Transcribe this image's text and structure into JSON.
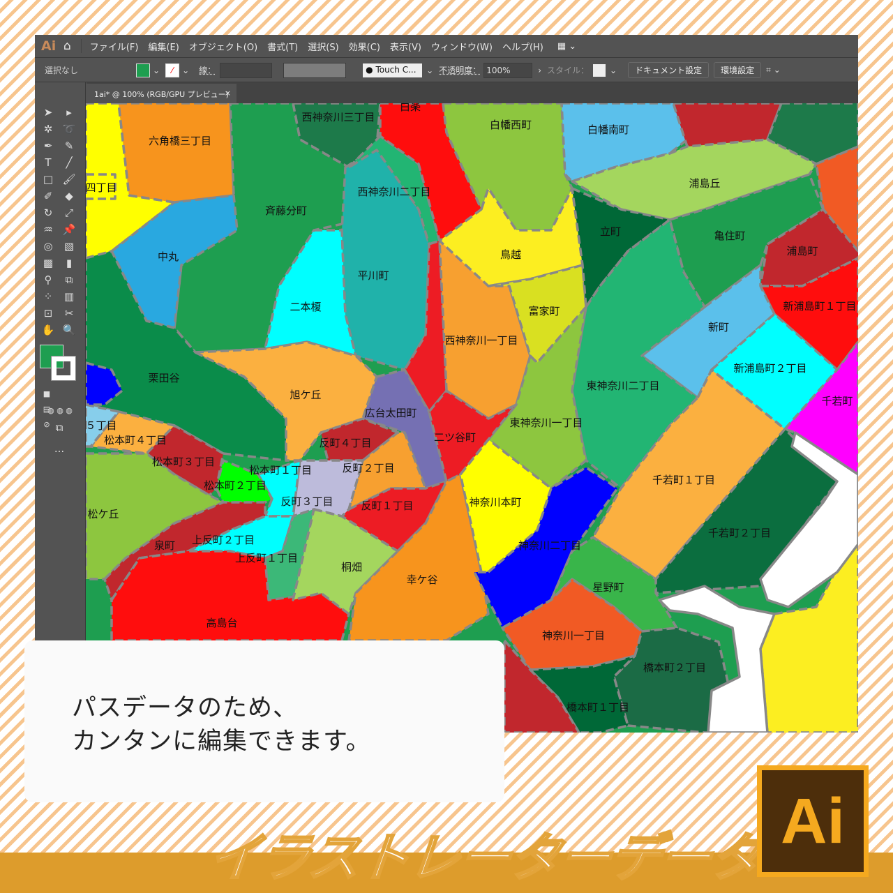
{
  "app": {
    "logo": "Ai",
    "home_icon": "home-icon",
    "menu": [
      "ファイル(F)",
      "編集(E)",
      "オブジェクト(O)",
      "書式(T)",
      "選択(S)",
      "効果(C)",
      "表示(V)",
      "ウィンドウ(W)",
      "ヘルプ(H)"
    ],
    "control": {
      "selection": "選択なし",
      "stroke_label": "線：",
      "brush": "Touch C...",
      "opacity_label": "不透明度：",
      "opacity": "100%",
      "style_label": "スタイル：",
      "doc_settings": "ドキュメント設定",
      "prefs": "環境設定",
      "fill_color": "#1E9E50"
    },
    "tab": {
      "title": "1ai* @ 100% (RGB/GPU プレビュー)",
      "close": "×"
    },
    "tools_more": "..."
  },
  "map": {
    "regions": [
      {
        "label": "",
        "color": "#FFFF00"
      },
      {
        "label": "六角橋三丁目",
        "color": "#F7941D"
      },
      {
        "label": "西神奈川三丁目",
        "color": "#1D7A4A"
      },
      {
        "label": "斉藤分町",
        "color": "#1E9E50"
      },
      {
        "label": "中丸",
        "color": "#29A8E0"
      },
      {
        "label": "栗田谷",
        "color": "#0A8C4A"
      },
      {
        "label": "二本榎",
        "color": "#00FFFF"
      },
      {
        "label": "平川町",
        "color": "#20B2AA"
      },
      {
        "label": "西神奈川二丁目",
        "color": "#22B573"
      },
      {
        "label": "白楽",
        "color": "#FF0D0D"
      },
      {
        "label": "",
        "color": "#ED1C24"
      },
      {
        "label": "西神奈川一丁目",
        "color": "#F7A030"
      },
      {
        "label": "白幡西町",
        "color": "#8DC63F"
      },
      {
        "label": "鳥越",
        "color": "#FCEE21"
      },
      {
        "label": "富家町",
        "color": "#D9E021"
      },
      {
        "label": "白幡南町",
        "color": "#5BC0EB"
      },
      {
        "label": "",
        "color": "#C1272D"
      },
      {
        "label": "",
        "color": "#1D7A4A"
      },
      {
        "label": "浦島丘",
        "color": "#A4D65E"
      },
      {
        "label": "",
        "color": "#F15A24"
      },
      {
        "label": "立町",
        "color": "#006837"
      },
      {
        "label": "亀住町",
        "color": "#1E9E50"
      },
      {
        "label": "浦島町",
        "color": "#C1272D"
      },
      {
        "label": "新浦島町１丁目",
        "color": "#FF0D0D"
      },
      {
        "label": "新町",
        "color": "#5BC0EB"
      },
      {
        "label": "新浦島町２丁目",
        "color": "#00FFFF"
      },
      {
        "label": "千若町",
        "color": "#FF00FF"
      },
      {
        "label": "東神奈川二丁目",
        "color": "#22B573"
      },
      {
        "label": "東神奈川一丁目",
        "color": "#8DC63F"
      },
      {
        "label": "千若町１丁目",
        "color": "#FBB040"
      },
      {
        "label": "千若町２丁目",
        "color": "#0B6E3F"
      },
      {
        "label": "",
        "color": "#FCEE21"
      },
      {
        "label": "旭ケ丘",
        "color": "#FBB040"
      },
      {
        "label": "広台太田町",
        "color": "#7570B3"
      },
      {
        "label": "二ツ谷町",
        "color": "#ED1C24"
      },
      {
        "label": "反町４丁目",
        "color": "#C1272D"
      },
      {
        "label": "反町２丁目",
        "color": "#F7A030"
      },
      {
        "label": "反町１丁目",
        "color": "#ED1C24"
      },
      {
        "label": "反町３丁目",
        "color": "#BDBBDB"
      },
      {
        "label": "松本町１丁目",
        "color": "#00FFFF"
      },
      {
        "label": "松本町２丁目",
        "color": "#00FF00"
      },
      {
        "label": "松本町３丁目",
        "color": "#C1272D"
      },
      {
        "label": "松本町４丁目",
        "color": "#FBB040"
      },
      {
        "label": "５丁目",
        "color": "#87CEEB"
      },
      {
        "label": "",
        "color": "#0000FF"
      },
      {
        "label": "松ケ丘",
        "color": "#8DC63F"
      },
      {
        "label": "泉町",
        "color": "#C1272D"
      },
      {
        "label": "上反町２丁目",
        "color": "#00FFFF"
      },
      {
        "label": "上反町１丁目",
        "color": "#3CB878"
      },
      {
        "label": "高島台",
        "color": "#FF0D0D"
      },
      {
        "label": "桐畑",
        "color": "#A4D65E"
      },
      {
        "label": "幸ケ谷",
        "color": "#F7941D"
      },
      {
        "label": "神奈川本町",
        "color": "#FFFF00"
      },
      {
        "label": "神奈川二丁目",
        "color": "#0000FF"
      },
      {
        "label": "星野町",
        "color": "#39B54A"
      },
      {
        "label": "神奈川一丁目",
        "color": "#F15A24"
      },
      {
        "label": "橋本町２丁目",
        "color": "#1B6B45"
      },
      {
        "label": "橋本町１丁目",
        "color": "#006837"
      },
      {
        "label": "",
        "color": "#C1272D"
      },
      {
        "label": "四丁目",
        "color": "#FFFF00"
      }
    ]
  },
  "callout": {
    "line1": "パスデータのため、",
    "line2": "カンタンに編集できます。"
  },
  "banner": {
    "title": "イラストレーターデータ",
    "logo": "Ai",
    "accent": "#DD9C2C"
  }
}
